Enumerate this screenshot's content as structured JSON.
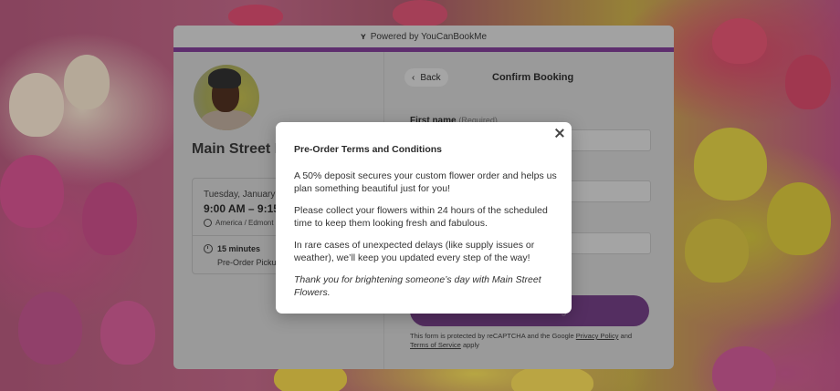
{
  "header": {
    "powered_by": "Powered by YouCanBookMe",
    "logo_icon": "ycbm-logo-icon"
  },
  "profile": {
    "title": "Main Street F"
  },
  "booking": {
    "date": "Tuesday, January 2",
    "time": "9:00 AM – 9:15 A",
    "timezone": "America / Edmont",
    "duration": "15 minutes",
    "type": "Pre-Order Picku"
  },
  "form": {
    "back_label": "Back",
    "title": "Confirm Booking",
    "first_name_label": "First name",
    "first_name_required": "(Required)",
    "confirm_label": "Confirm Booking",
    "captcha_prefix": "This form is protected by reCAPTCHA and the Google",
    "privacy_link": "Privacy Policy",
    "captcha_and": "and",
    "terms_link": "Terms of Service",
    "captcha_suffix": "apply"
  },
  "modal": {
    "title": "Pre-Order Terms and Conditions",
    "p1": "A 50% deposit secures your custom flower order and helps us plan something beautiful just for you!",
    "p2": "Please collect your flowers within 24 hours of the scheduled time to keep them looking fresh and fabulous.",
    "p3": "In rare cases of unexpected delays (like supply issues or weather), we’ll keep you updated every step of the way!",
    "p4": "Thank you for brightening someone’s day with Main Street Flowers."
  },
  "colors": {
    "accent": "#7a3f8c",
    "modal_bg": "#ffffff"
  }
}
